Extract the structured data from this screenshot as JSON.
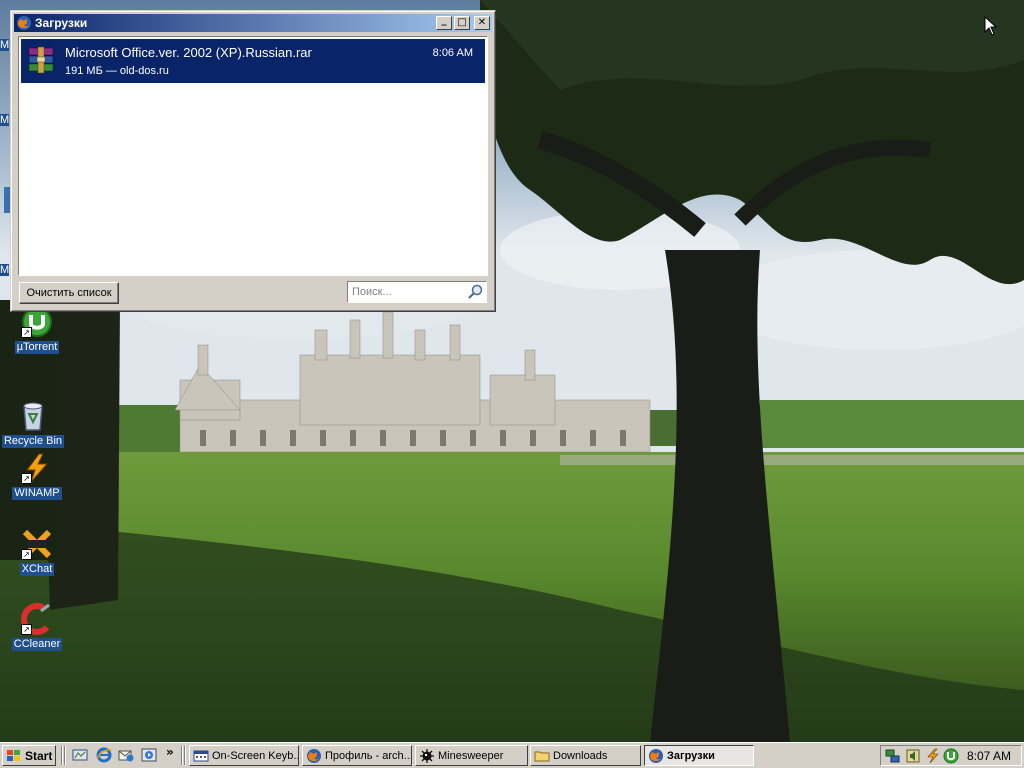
{
  "desktop": {
    "icons": [
      {
        "label": "µTorrent"
      },
      {
        "label": "Recycle Bin"
      },
      {
        "label": "WINAMP"
      },
      {
        "label": "XChat"
      },
      {
        "label": "CCleaner"
      }
    ],
    "partial_labels": [
      "M",
      "M",
      "M"
    ]
  },
  "window": {
    "title": "Загрузки",
    "controls": {
      "minimize": "_",
      "maximize": "□",
      "close": "✕"
    },
    "downloads": [
      {
        "filename": "Microsoft Office.ver. 2002 (XP).Russian.rar",
        "meta": "191 МБ — old-dos.ru",
        "time": "8:06 AM",
        "icon": "winrar-archive-icon"
      }
    ],
    "clear_button": "Очистить список",
    "search_placeholder": "Поиск..."
  },
  "taskbar": {
    "start_label": "Start",
    "quick_more": "»",
    "tasks": [
      {
        "label": "On-Screen Keyb..."
      },
      {
        "label": "Профиль - arch..."
      },
      {
        "label": "Minesweeper"
      },
      {
        "label": "Downloads"
      },
      {
        "label": "Загрузки"
      }
    ],
    "clock": "8:07 AM"
  },
  "colors": {
    "titlebar_start": "#0a246a",
    "titlebar_end": "#a6caf0",
    "selection": "#0a246a",
    "face": "#d4d0c8"
  }
}
